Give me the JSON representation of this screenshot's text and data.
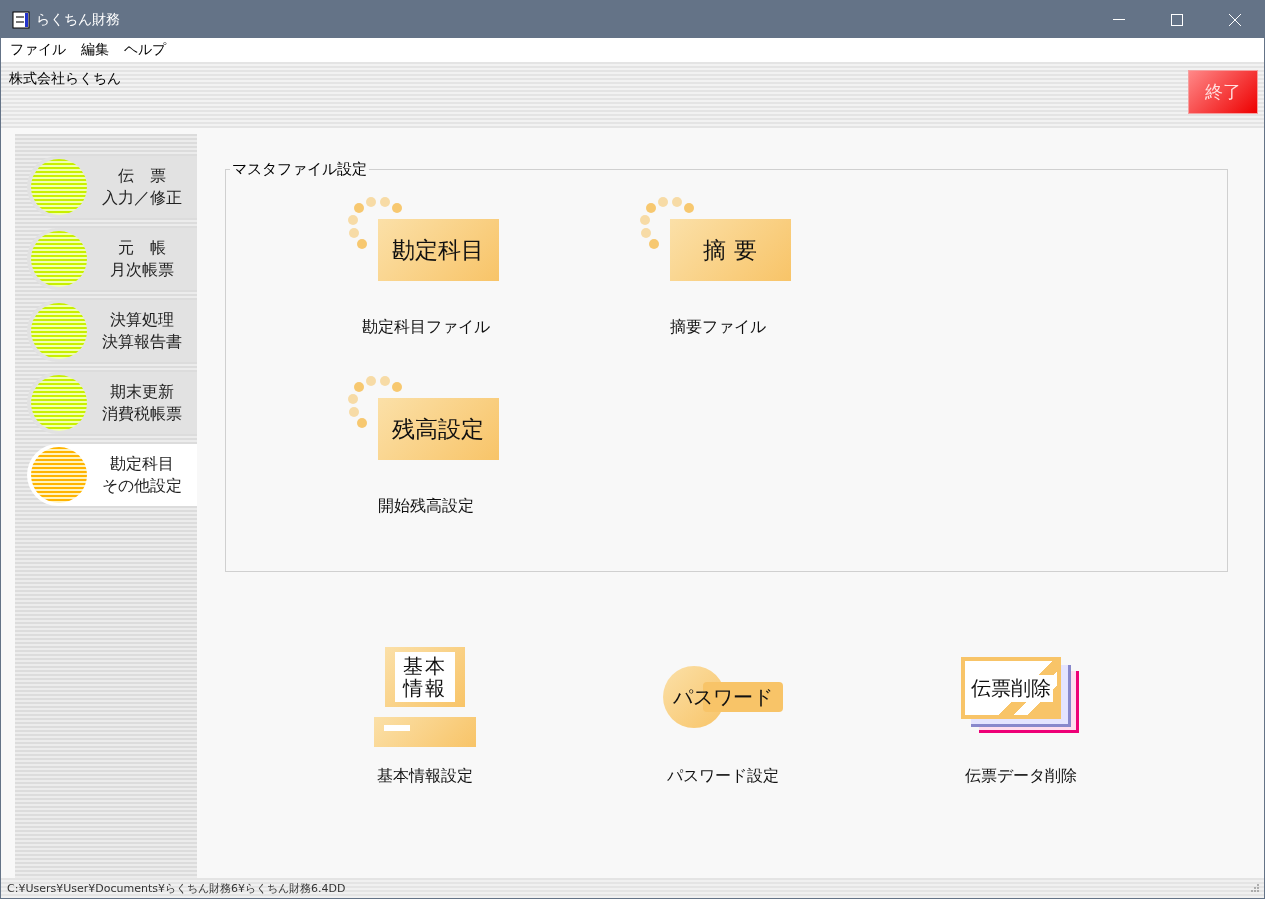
{
  "window": {
    "title": "らくちん財務"
  },
  "menu": [
    "ファイル",
    "編集",
    "ヘルプ"
  ],
  "header": {
    "company": "株式会社らくちん",
    "exit_button": "終了"
  },
  "sidebar": {
    "items": [
      {
        "lines": [
          "伝　票",
          "入力／修正"
        ],
        "selected": false
      },
      {
        "lines": [
          "元　帳",
          "月次帳票"
        ],
        "selected": false
      },
      {
        "lines": [
          "決算処理",
          "決算報告書"
        ],
        "selected": false
      },
      {
        "lines": [
          "期末更新",
          "消費税帳票"
        ],
        "selected": false
      },
      {
        "lines": [
          "勘定科目",
          "その他設定"
        ],
        "selected": true
      }
    ]
  },
  "master_group": {
    "title": "マスタファイル設定",
    "items": [
      {
        "kind": "card",
        "tile_text": "勘定科目",
        "label": "勘定科目ファイル"
      },
      {
        "kind": "card",
        "tile_text": "摘 要",
        "label": "摘要ファイル"
      },
      {
        "kind": "card",
        "tile_text": "残高設定",
        "label": "開始残高設定"
      }
    ]
  },
  "tools": [
    {
      "kind": "monitor",
      "tile_text": "基本情報",
      "label": "基本情報設定"
    },
    {
      "kind": "key",
      "tile_text": "パスワード",
      "label": "パスワード設定"
    },
    {
      "kind": "stack",
      "tile_text": "伝票削除",
      "label": "伝票データ削除"
    }
  ],
  "status_bar": {
    "path": "C:¥Users¥User¥Documents¥らくちん財務6¥らくちん財務6.4DD"
  }
}
